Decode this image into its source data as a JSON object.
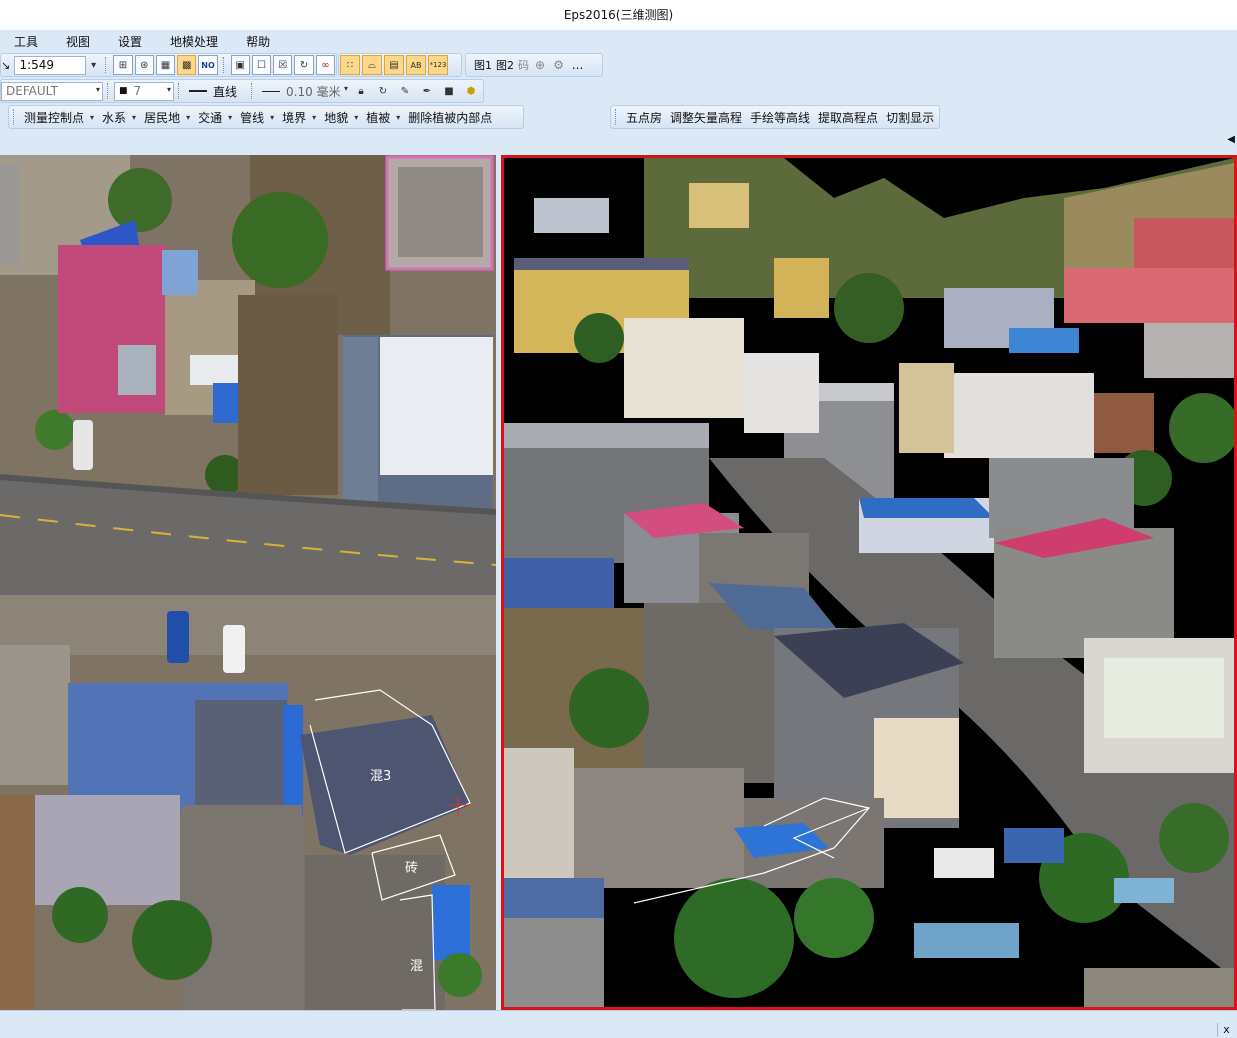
{
  "window": {
    "title": "Eps2016(三维测图)"
  },
  "menu": [
    "工具",
    "视图",
    "设置",
    "地模处理",
    "帮助"
  ],
  "toolbar1": {
    "scale": "1:549",
    "view_buttons": [
      "grid-4-icon",
      "grid-circle-icon",
      "grid-table-icon",
      "grid-fill-icon",
      "grid-label-icon"
    ],
    "edit_buttons": [
      "map-layer-icon",
      "map-select-icon",
      "map-pan-icon",
      "map-rotate-icon",
      "map-link-icon"
    ],
    "snap_buttons": [
      "snap-point-icon",
      "snap-line-icon",
      "snap-block-icon",
      "snap-text-icon",
      "snap-number-icon"
    ],
    "map_toggles": [
      "图1",
      "图2",
      "码"
    ],
    "more": "..."
  },
  "toolbar2": {
    "layer": "DEFAULT",
    "color_index": "7",
    "linetype": "直线",
    "lineweight": "0.10 毫米"
  },
  "toolbar3": {
    "items": [
      "测量控制点",
      "水系",
      "居民地",
      "交通",
      "管线",
      "境界",
      "地貌",
      "植被",
      "删除植被内部点"
    ]
  },
  "toolbar4": {
    "items": [
      "五点房",
      "调整矢量高程",
      "手绘等高线",
      "提取高程点",
      "切割显示"
    ]
  },
  "map_labels": {
    "label1": "混3",
    "label2": "砖",
    "label3": "混"
  },
  "status": {
    "close": "x"
  }
}
